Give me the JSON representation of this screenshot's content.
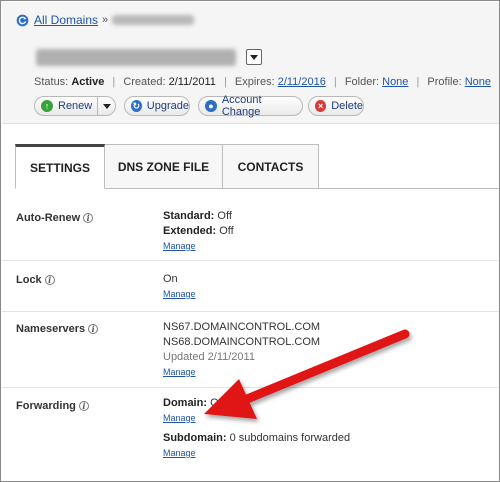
{
  "breadcrumb": {
    "all_domains": "All Domains",
    "separator": "»"
  },
  "domain": {
    "dropdown_icon": "chevron-down-icon"
  },
  "status": {
    "status_label": "Status:",
    "status_value": "Active",
    "created_label": "Created:",
    "created_value": "2/11/2011",
    "expires_label": "Expires:",
    "expires_value": "2/11/2016",
    "folder_label": "Folder:",
    "folder_value": "None",
    "profile_label": "Profile:",
    "profile_value": "None"
  },
  "actions": {
    "renew": "Renew",
    "upgrade": "Upgrade",
    "account_change": "Account Change",
    "delete": "Delete"
  },
  "tabs": [
    {
      "label": "SETTINGS",
      "active": true
    },
    {
      "label": "DNS ZONE FILE",
      "active": false
    },
    {
      "label": "CONTACTS",
      "active": false
    }
  ],
  "settings": {
    "auto_renew": {
      "label": "Auto-Renew",
      "standard_label": "Standard:",
      "standard_value": "Off",
      "extended_label": "Extended:",
      "extended_value": "Off",
      "manage": "Manage"
    },
    "lock": {
      "label": "Lock",
      "value": "On",
      "manage": "Manage"
    },
    "nameservers": {
      "label": "Nameservers",
      "ns1": "NS67.DOMAINCONTROL.COM",
      "ns2": "NS68.DOMAINCONTROL.COM",
      "updated": "Updated 2/11/2011",
      "manage": "Manage"
    },
    "forwarding": {
      "label": "Forwarding",
      "domain_label": "Domain:",
      "domain_value": "Off",
      "manage": "Manage",
      "subdomain_label": "Subdomain:",
      "subdomain_value": "0 subdomains forwarded",
      "manage2": "Manage"
    }
  },
  "colors": {
    "link": "#1e55a8",
    "arrow": "#e01818",
    "renew_icon": "#3aa23a",
    "delete_icon": "#d83a3a",
    "blue_icon": "#2d6fc7"
  }
}
